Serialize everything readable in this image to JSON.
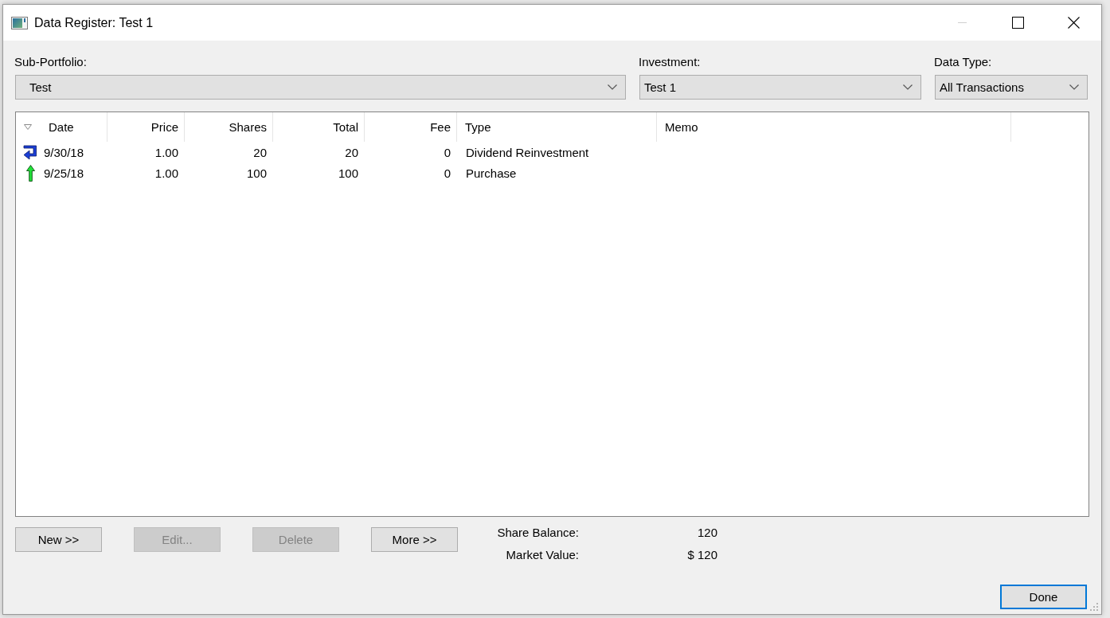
{
  "window": {
    "title": "Data Register: Test 1",
    "minimize_disabled": true
  },
  "selectors": [
    {
      "label": "Sub-Portfolio:",
      "value": "Test"
    },
    {
      "label": "Investment:",
      "value": "Test 1"
    },
    {
      "label": "Data Type:",
      "value": "All Transactions"
    }
  ],
  "table": {
    "columns": [
      {
        "label": "Date",
        "kind": "text",
        "sorted": true
      },
      {
        "label": "Price",
        "kind": "number",
        "sorted": false
      },
      {
        "label": "Shares",
        "kind": "number",
        "sorted": false
      },
      {
        "label": "Total",
        "kind": "number",
        "sorted": false
      },
      {
        "label": "Fee",
        "kind": "number",
        "sorted": false
      },
      {
        "label": "Type",
        "kind": "text",
        "sorted": false
      },
      {
        "label": "Memo",
        "kind": "text",
        "sorted": false
      }
    ],
    "rows": [
      {
        "kind": "reinvestment",
        "cells": [
          "9/30/18",
          "1.00",
          "20",
          "20",
          "0",
          "Dividend Reinvestment"
        ]
      },
      {
        "kind": "purchase",
        "cells": [
          "9/25/18",
          "1.00",
          "100",
          "100",
          "0",
          "Purchase"
        ]
      }
    ]
  },
  "buttons": [
    {
      "label": "New >>",
      "disabled": false
    },
    {
      "label": "Edit...",
      "disabled": true
    },
    {
      "label": "Delete",
      "disabled": true
    },
    {
      "label": "More >>",
      "disabled": false
    }
  ],
  "summary": [
    {
      "label": "Share Balance:",
      "value": "120"
    },
    {
      "label": "Market Value:",
      "value": "$ 120"
    }
  ],
  "done_button": {
    "label": "Done",
    "default": true
  }
}
